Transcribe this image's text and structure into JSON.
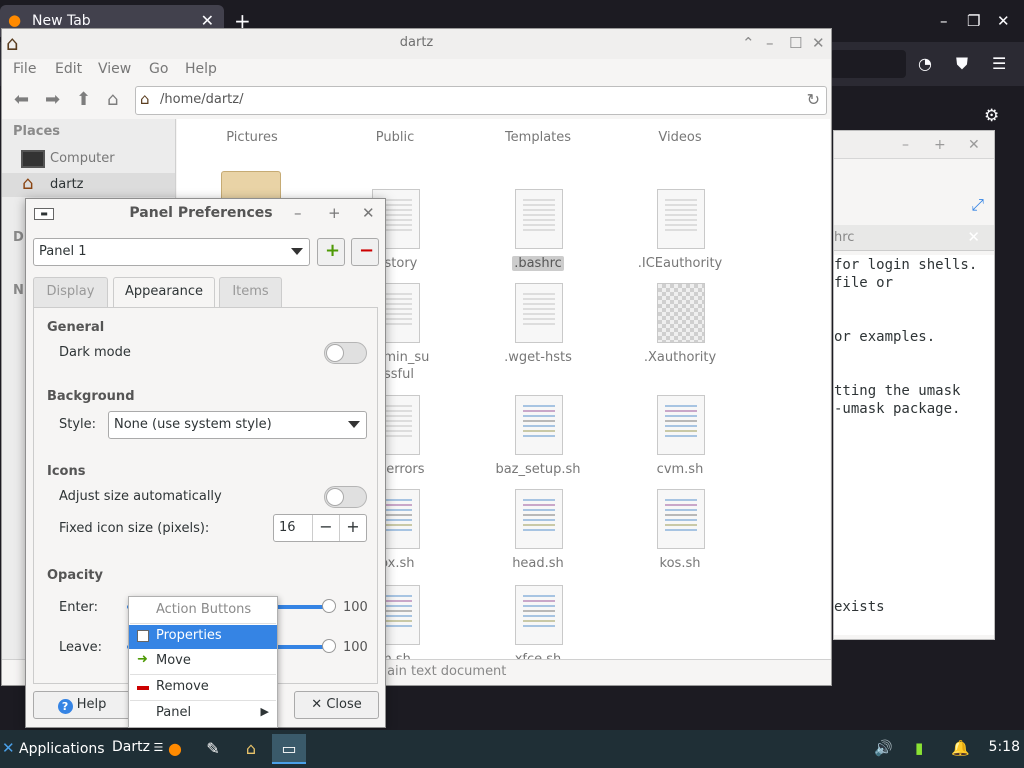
{
  "browser": {
    "tab_title": "New Tab",
    "tab_close": "✕",
    "new_tab": "+",
    "controls": [
      "–",
      "❐",
      "✕"
    ],
    "toolbar_icons": [
      "incognito-icon",
      "ublock-icon",
      "menu-icon"
    ]
  },
  "editor": {
    "tab_name": "hrc",
    "lines": [
      "for login shells.",
      "file or",
      "",
      "",
      "or examples.",
      "",
      "",
      "tting the umask",
      "-umask package.",
      "",
      "",
      "",
      "",
      "",
      "",
      "",
      "",
      "",
      "exists"
    ]
  },
  "file_manager": {
    "title": "dartz",
    "menu": [
      "File",
      "Edit",
      "View",
      "Go",
      "Help"
    ],
    "path": "/home/dartz/",
    "places_header": "Places",
    "places": [
      {
        "label": "Computer",
        "icon": "computer-icon"
      },
      {
        "label": "dartz",
        "icon": "home-icon"
      }
    ],
    "sidebar_partial": [
      "D",
      "N"
    ],
    "top_row": [
      "Pictures",
      "Public",
      "Templates",
      "Videos"
    ],
    "files": [
      {
        "name": "history",
        "col": 1,
        "row": 0
      },
      {
        "name": ".bashrc",
        "col": 2,
        "row": 0,
        "highlight": true
      },
      {
        "name": ".ICEauthority",
        "col": 3,
        "row": 0
      },
      {
        "name": "_admin_su\nessful",
        "col": 1,
        "row": 1
      },
      {
        "name": ".wget-hsts",
        "col": 2,
        "row": 1
      },
      {
        "name": ".Xauthority",
        "col": 3,
        "row": 1,
        "checker": true
      },
      {
        "name": "on-errors",
        "col": 1,
        "row": 2
      },
      {
        "name": "baz_setup.sh",
        "col": 2,
        "row": 2,
        "script": true
      },
      {
        "name": "cvm.sh",
        "col": 3,
        "row": 2,
        "script": true
      },
      {
        "name": "fox.sh",
        "col": 1,
        "row": 3,
        "script": true
      },
      {
        "name": "head.sh",
        "col": 2,
        "row": 3,
        "script": true
      },
      {
        "name": "kos.sh",
        "col": 3,
        "row": 3,
        "script": true
      },
      {
        "name": "m.sh",
        "col": 1,
        "row": 4,
        "script": true
      },
      {
        "name": "xfce.sh",
        "col": 2,
        "row": 4,
        "script": true
      }
    ],
    "status": ") plain text document"
  },
  "panel_prefs": {
    "title": "Panel Preferences",
    "panel_select": "Panel 1",
    "add_label": "+",
    "remove_label": "−",
    "tabs": [
      {
        "label": "Display",
        "active": false
      },
      {
        "label": "Appearance",
        "active": true
      },
      {
        "label": "Items",
        "active": false
      }
    ],
    "general": {
      "title": "General",
      "dark_mode_label": "Dark mode",
      "dark_mode": false
    },
    "background": {
      "title": "Background",
      "style_label": "Style:",
      "style_value": "None (use system style)"
    },
    "icons": {
      "title": "Icons",
      "adjust_label": "Adjust size automatically",
      "adjust": false,
      "fixed_label": "Fixed icon size (pixels):",
      "fixed_value": "16",
      "minus": "−",
      "plus": "+"
    },
    "opacity": {
      "title": "Opacity",
      "enter_label": "Enter:",
      "enter_value": "100",
      "leave_label": "Leave:",
      "leave_value": "100"
    },
    "help_label": "Help",
    "close_label": "Close"
  },
  "context_menu": {
    "header": "Action Buttons",
    "items": [
      {
        "label": "Properties",
        "selected": true
      },
      {
        "label": "Move",
        "selected": false
      },
      {
        "label": "Remove",
        "selected": false
      },
      {
        "label": "Panel",
        "selected": false,
        "submenu": true
      }
    ]
  },
  "taskbar": {
    "applications": "Applications",
    "window": "Dartz",
    "clock": "5:18"
  }
}
